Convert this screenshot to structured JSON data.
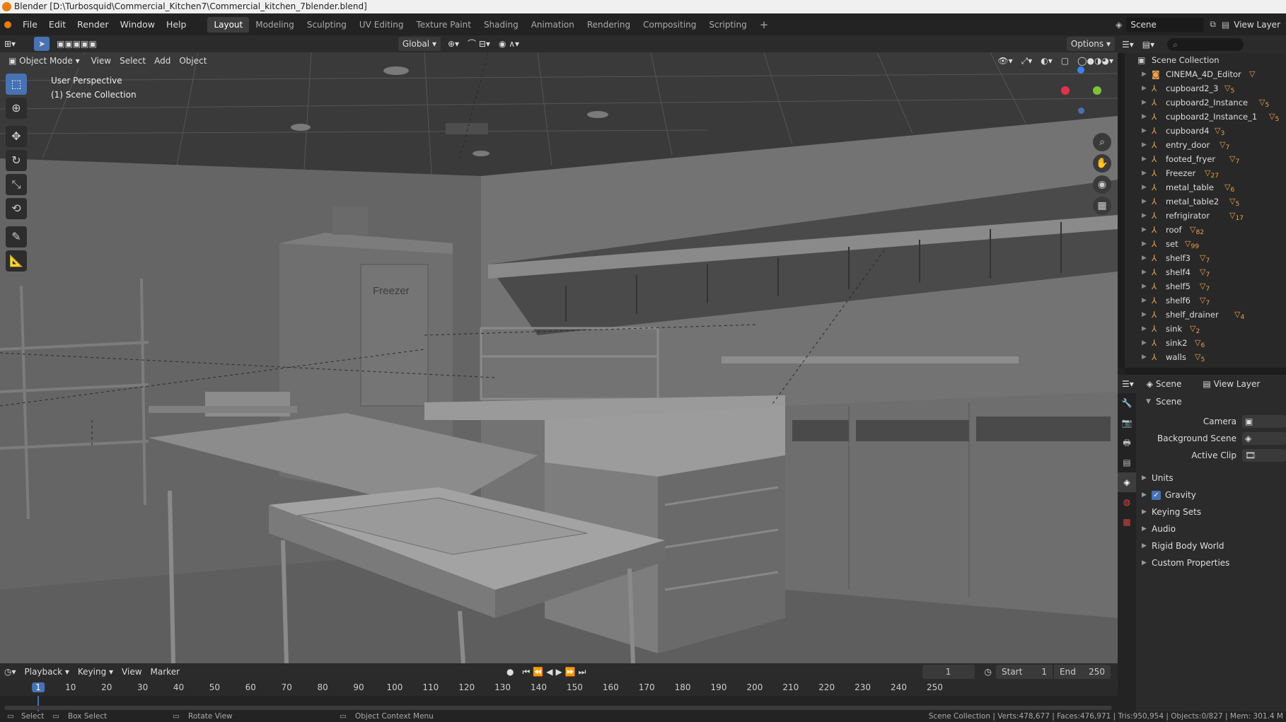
{
  "window": {
    "title": "Blender [D:\\Turbosquid\\Commercial_Kitchen7\\Commercial_kitchen_7blender.blend]"
  },
  "menus": [
    "File",
    "Edit",
    "Render",
    "Window",
    "Help"
  ],
  "workspaces": [
    "Layout",
    "Modeling",
    "Sculpting",
    "UV Editing",
    "Texture Paint",
    "Shading",
    "Animation",
    "Rendering",
    "Compositing",
    "Scripting"
  ],
  "active_workspace": "Layout",
  "scene_field": "Scene",
  "view_layer_field": "View Layer",
  "toolheader": {
    "orientation": "Global",
    "options": "Options"
  },
  "viewport_header": {
    "mode": "Object Mode",
    "menus": [
      "View",
      "Select",
      "Add",
      "Object"
    ]
  },
  "viewport": {
    "perspective": "User Perspective",
    "collection": "(1) Scene Collection",
    "freezer_label": "Freezer"
  },
  "outliner": {
    "root": "Scene Collection",
    "items": [
      {
        "name": "CINEMA_4D_Editor",
        "badge": ""
      },
      {
        "name": "cupboard2_3",
        "badge": "5"
      },
      {
        "name": "cupboard2_Instance",
        "badge": "5"
      },
      {
        "name": "cupboard2_Instance_1",
        "badge": "5"
      },
      {
        "name": "cupboard4",
        "badge": "3"
      },
      {
        "name": "entry_door",
        "badge": "7"
      },
      {
        "name": "footed_fryer",
        "badge": "7"
      },
      {
        "name": "Freezer",
        "badge": "27"
      },
      {
        "name": "metal_table",
        "badge": "6"
      },
      {
        "name": "metal_table2",
        "badge": "5"
      },
      {
        "name": "refrigirator",
        "badge": "17"
      },
      {
        "name": "roof",
        "badge": "82"
      },
      {
        "name": "set",
        "badge": "99"
      },
      {
        "name": "shelf3",
        "badge": "7"
      },
      {
        "name": "shelf4",
        "badge": "7"
      },
      {
        "name": "shelf5",
        "badge": "7"
      },
      {
        "name": "shelf6",
        "badge": "7"
      },
      {
        "name": "shelf_drainer",
        "badge": "4"
      },
      {
        "name": "sink",
        "badge": "2"
      },
      {
        "name": "sink2",
        "badge": "6"
      },
      {
        "name": "walls",
        "badge": "5"
      }
    ]
  },
  "properties": {
    "header_scene": "Scene",
    "header_view_layer": "View Layer",
    "panel": "Scene",
    "fields": [
      {
        "label": "Camera"
      },
      {
        "label": "Background Scene"
      },
      {
        "label": "Active Clip"
      }
    ],
    "sections": [
      "Units",
      "Gravity",
      "Keying Sets",
      "Audio",
      "Rigid Body World",
      "Custom Properties"
    ]
  },
  "timeline": {
    "menus": [
      "Playback",
      "Keying",
      "View",
      "Marker"
    ],
    "current_frame": "1",
    "start_label": "Start",
    "start": "1",
    "end_label": "End",
    "end": "250",
    "ticks": [
      "1",
      "10",
      "20",
      "30",
      "40",
      "50",
      "60",
      "70",
      "80",
      "90",
      "100",
      "110",
      "120",
      "130",
      "140",
      "150",
      "160",
      "170",
      "180",
      "190",
      "200",
      "210",
      "220",
      "230",
      "240",
      "250"
    ]
  },
  "status": {
    "select": "Select",
    "box_select": "Box Select",
    "rotate": "Rotate View",
    "context": "Object Context Menu",
    "stats": "Scene Collection | Verts:478,677 | Faces:476,971 | Tris:950,954 | Objects:0/827 | Mem: 301.4 M"
  },
  "colors": {
    "accent": "#4772b3",
    "orange": "#e8a24e",
    "bg": "#1d1d1d",
    "panel": "#2b2b2b"
  }
}
